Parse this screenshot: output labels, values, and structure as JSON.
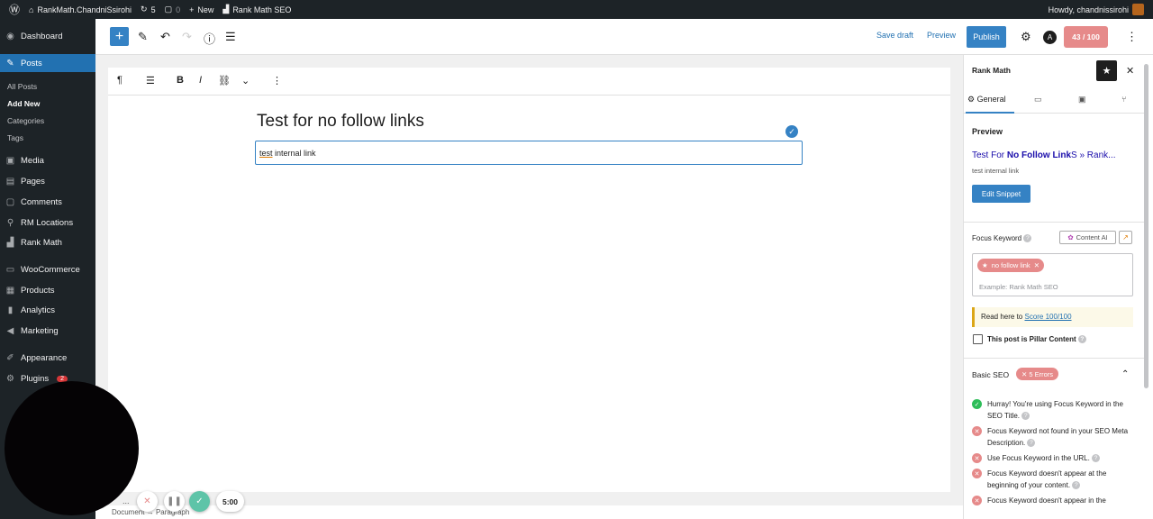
{
  "admin_bar": {
    "site_name": "RankMath.ChandniSsirohi",
    "updates_count": "5",
    "comments_count": "0",
    "new_label": "New",
    "rankmath_label": "Rank Math SEO",
    "howdy": "Howdy, chandnissirohi"
  },
  "sidebar": {
    "items": [
      {
        "label": "Dashboard",
        "icon": "dashboard-icon"
      },
      {
        "label": "Posts",
        "icon": "pin-icon"
      },
      {
        "label": "Media",
        "icon": "media-icon"
      },
      {
        "label": "Pages",
        "icon": "pages-icon"
      },
      {
        "label": "Comments",
        "icon": "comment-icon"
      },
      {
        "label": "RM Locations",
        "icon": "location-icon"
      },
      {
        "label": "Rank Math",
        "icon": "chart-icon"
      },
      {
        "label": "WooCommerce",
        "icon": "woo-icon"
      },
      {
        "label": "Products",
        "icon": "box-icon"
      },
      {
        "label": "Analytics",
        "icon": "bars-icon"
      },
      {
        "label": "Marketing",
        "icon": "megaphone-icon"
      },
      {
        "label": "Appearance",
        "icon": "brush-icon"
      },
      {
        "label": "Plugins",
        "icon": "plugin-icon"
      }
    ],
    "plugins_badge": "2",
    "posts_sub": [
      "All Posts",
      "Add New",
      "Categories",
      "Tags"
    ]
  },
  "toolbar": {
    "save_draft": "Save draft",
    "preview": "Preview",
    "publish": "Publish",
    "score": "43 / 100"
  },
  "editor": {
    "title": "Test for no follow links",
    "paragraph_prefix": "test",
    "paragraph_rest": " internal link",
    "breadcrumb_doc": "Document",
    "breadcrumb_arrow": "→",
    "breadcrumb_block": "Paragraph"
  },
  "rank_math": {
    "panel_title": "Rank Math",
    "tab_general": "General",
    "preview_heading": "Preview",
    "snippet_title_a": "Test For ",
    "snippet_title_b": "No Follow Link",
    "snippet_title_c": "S » Rank...",
    "snippet_desc": "test internal link",
    "edit_snippet": "Edit Snippet",
    "focus_keyword_label": "Focus Keyword",
    "content_ai": "Content AI",
    "keyword": "no follow link",
    "keyword_placeholder": "Example: Rank Math SEO",
    "read_here": "Read here to ",
    "score_link": "Score 100/100",
    "pillar_label": "This post is Pillar Content",
    "basic_seo": "Basic SEO",
    "errors_badge": "5 Errors",
    "checks": [
      {
        "status": "ok",
        "text": "Hurray! You're using Focus Keyword in the SEO Title."
      },
      {
        "status": "bad",
        "text": "Focus Keyword not found in your SEO Meta Description."
      },
      {
        "status": "bad",
        "text": "Use Focus Keyword in the URL."
      },
      {
        "status": "bad",
        "text": "Focus Keyword doesn't appear at the beginning of your content."
      },
      {
        "status": "bad",
        "text": "Focus Keyword doesn't appear in the"
      }
    ]
  },
  "recorder": {
    "time": "5:00",
    "more": "..."
  },
  "colors": {
    "admin_dark": "#1d2327",
    "accent_blue": "#3582c4",
    "error_red": "#e68a8a",
    "ok_green": "#2ebd59"
  }
}
